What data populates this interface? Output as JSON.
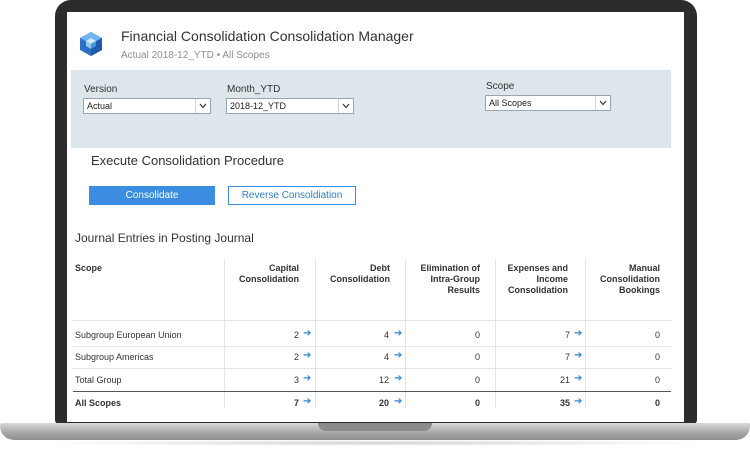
{
  "header": {
    "title": "Financial Consolidation Consolidation Manager",
    "subtitle": "Actual 2018-12_YTD • All Scopes",
    "logo_icon": "cube-logo-icon"
  },
  "filters": {
    "version": {
      "label": "Version",
      "value": "Actual"
    },
    "month": {
      "label": "Month_YTD",
      "value": "2018-12_YTD"
    },
    "scope": {
      "label": "Scope",
      "value": "All Scopes"
    }
  },
  "execute": {
    "title": "Execute Consolidation Procedure",
    "consolidate_label": "Consolidate",
    "reverse_label": "Reverse Consoldiation"
  },
  "journal": {
    "title": "Journal Entries in Posting Journal",
    "columns": {
      "scope": "Scope",
      "capital": [
        "Capital",
        "Consolidation"
      ],
      "debt": [
        "Debt",
        "Consolidation"
      ],
      "elimination": [
        "Elimination of",
        "Intra-Group",
        "Results"
      ],
      "expenses": [
        "Expenses and",
        "Income",
        "Consolidation"
      ],
      "manual": [
        "Manual",
        "Consolidation",
        "Bookings"
      ]
    },
    "rows": [
      {
        "scope": "Subgroup European Union",
        "capital": "2",
        "debt": "4",
        "elimination": "0",
        "expenses": "7",
        "manual": "0"
      },
      {
        "scope": "Subgroup Americas",
        "capital": "2",
        "debt": "4",
        "elimination": "0",
        "expenses": "7",
        "manual": "0"
      },
      {
        "scope": "Total Group",
        "capital": "3",
        "debt": "12",
        "elimination": "0",
        "expenses": "21",
        "manual": "0"
      }
    ],
    "total": {
      "scope": "All Scopes",
      "capital": "7",
      "debt": "20",
      "elimination": "0",
      "expenses": "35",
      "manual": "0"
    }
  },
  "colors": {
    "accent": "#3a8de0",
    "filter_bg": "#dde6ea",
    "frame": "#2c2c2e"
  }
}
